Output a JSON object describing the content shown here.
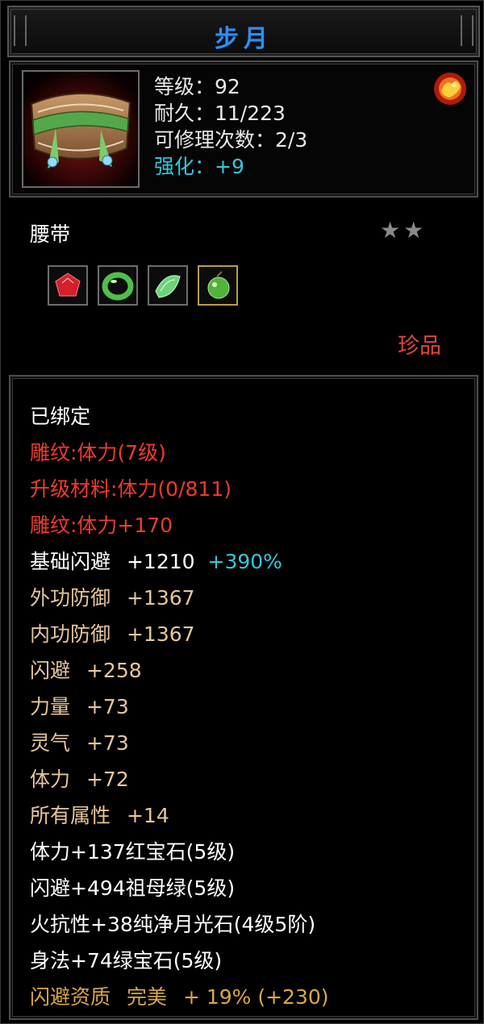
{
  "window": {
    "title": "步月"
  },
  "item": {
    "icon": "waist-belt-icon",
    "level_label": "等级：92",
    "durability_label": "耐久：11/223",
    "repair_label": "可修理次数：2/3",
    "enhance_label": "强化：+9",
    "badge_icon": "fire-seal-icon",
    "type": "腰带",
    "stars": "★★",
    "star_rating": 2,
    "rarity": "珍品",
    "gem_slots": [
      {
        "icon": "red-gem-icon"
      },
      {
        "icon": "green-ring-gem-icon"
      },
      {
        "icon": "green-crystal-gem-icon"
      },
      {
        "icon": "green-fruit-gem-icon",
        "selected": true
      }
    ]
  },
  "attributes": {
    "bound": "已绑定",
    "engrave": "雕纹:体力(7级)",
    "upgrade_material": "升级材料:体力(0/811)",
    "engrave_bonus": "雕纹:体力+170",
    "base_dodge_label": "基础闪避",
    "base_dodge_value": "+1210",
    "base_dodge_pct": "+390%",
    "outer_def_label": "外功防御",
    "outer_def_value": "+1367",
    "inner_def_label": "内功防御",
    "inner_def_value": "+1367",
    "dodge_label": "闪避",
    "dodge_value": "+258",
    "strength_label": "力量",
    "strength_value": "+73",
    "spirit_label": "灵气",
    "spirit_value": "+73",
    "stamina_label": "体力",
    "stamina_value": "+72",
    "all_attr_label": "所有属性",
    "all_attr_value": "+14",
    "gem_line_1": "体力+137红宝石(5级)",
    "gem_line_2": "闪避+494祖母绿(5级)",
    "gem_line_3": "火抗性+38纯净月光石(4级5阶)",
    "gem_line_4": "身法+74绿宝石(5级)",
    "quality_label": "闪避资质",
    "quality_grade": "完美",
    "quality_value": "+ 19% (+230)"
  },
  "colors": {
    "title": "#2e8ff0",
    "enhance": "#36c7dc",
    "red_text": "#ee3b2b",
    "tan_text": "#e6c69a",
    "rarity": "#e0463a",
    "quality": "#d8a845"
  }
}
